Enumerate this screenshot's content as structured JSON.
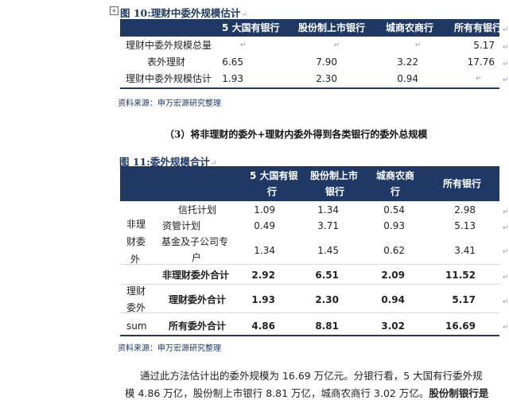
{
  "table10": {
    "anchor": "+",
    "title": "图 10:理财中委外规模估计",
    "headers": [
      "",
      "5 大国有银行",
      "股份制上市银行",
      "城商农商行",
      "所有有银行"
    ],
    "rows": [
      {
        "label": "理财中委外规模总量",
        "values": [
          "",
          "",
          "",
          "5.17"
        ]
      },
      {
        "label": "表外理财",
        "values": [
          "6.65",
          "7.90",
          "3.22",
          "17.76"
        ]
      },
      {
        "label": "理财中委外规模估计",
        "values": [
          "1.93",
          "2.30",
          "0.94",
          ""
        ]
      }
    ],
    "source": "资料来源：申万宏源研究整理"
  },
  "section_heading": "（3）将非理财的委外+理财内委外得到各类银行的委外总规模",
  "table11": {
    "title": "图 11:委外规模合计",
    "headers": {
      "big5_line1": "5 大国有银",
      "big5_line2": "行",
      "joint_line1": "股份制上市",
      "joint_line2": "银行",
      "city_line1": "城商农商",
      "city_line2": "行",
      "all": "所有银行"
    },
    "group_labels": {
      "nonwm_1": "非理",
      "nonwm_2": "财委",
      "nonwm_3": "外",
      "wm_1": "理财",
      "wm_2": "委外",
      "sum": "sum"
    },
    "rows": [
      {
        "label": "信托计划",
        "values": [
          "1.09",
          "1.34",
          "0.54",
          "2.98"
        ]
      },
      {
        "label": "资管计划",
        "values": [
          "0.49",
          "3.71",
          "0.93",
          "5.13"
        ]
      },
      {
        "label_line1": "基金及子公司专",
        "label_line2": "户",
        "values": [
          "1.34",
          "1.45",
          "0.62",
          "3.41"
        ]
      },
      {
        "label": "非理财委外合计",
        "values": [
          "2.92",
          "6.51",
          "2.09",
          "11.52"
        ]
      },
      {
        "label": "理财委外合计",
        "values": [
          "1.93",
          "2.30",
          "0.94",
          "5.17"
        ]
      },
      {
        "label": "所有委外合计",
        "values": [
          "4.86",
          "8.81",
          "3.02",
          "16.69"
        ]
      }
    ],
    "source": "资料来源：申万宏源研究整理"
  },
  "paragraph": {
    "line1": "通过此方法估计出的委外规模为 16.69 万亿元。分银行看，5 大国有行委外规",
    "line2_plain": "模 4.86 万亿，股份制上市银行 8.81 万亿，城商农商行 3.02 万亿。",
    "line2_bold": "股份制银行是"
  },
  "colors": {
    "navy": "#1f3864",
    "source_text": "#1f3864",
    "mark": "#9a9a9a"
  }
}
